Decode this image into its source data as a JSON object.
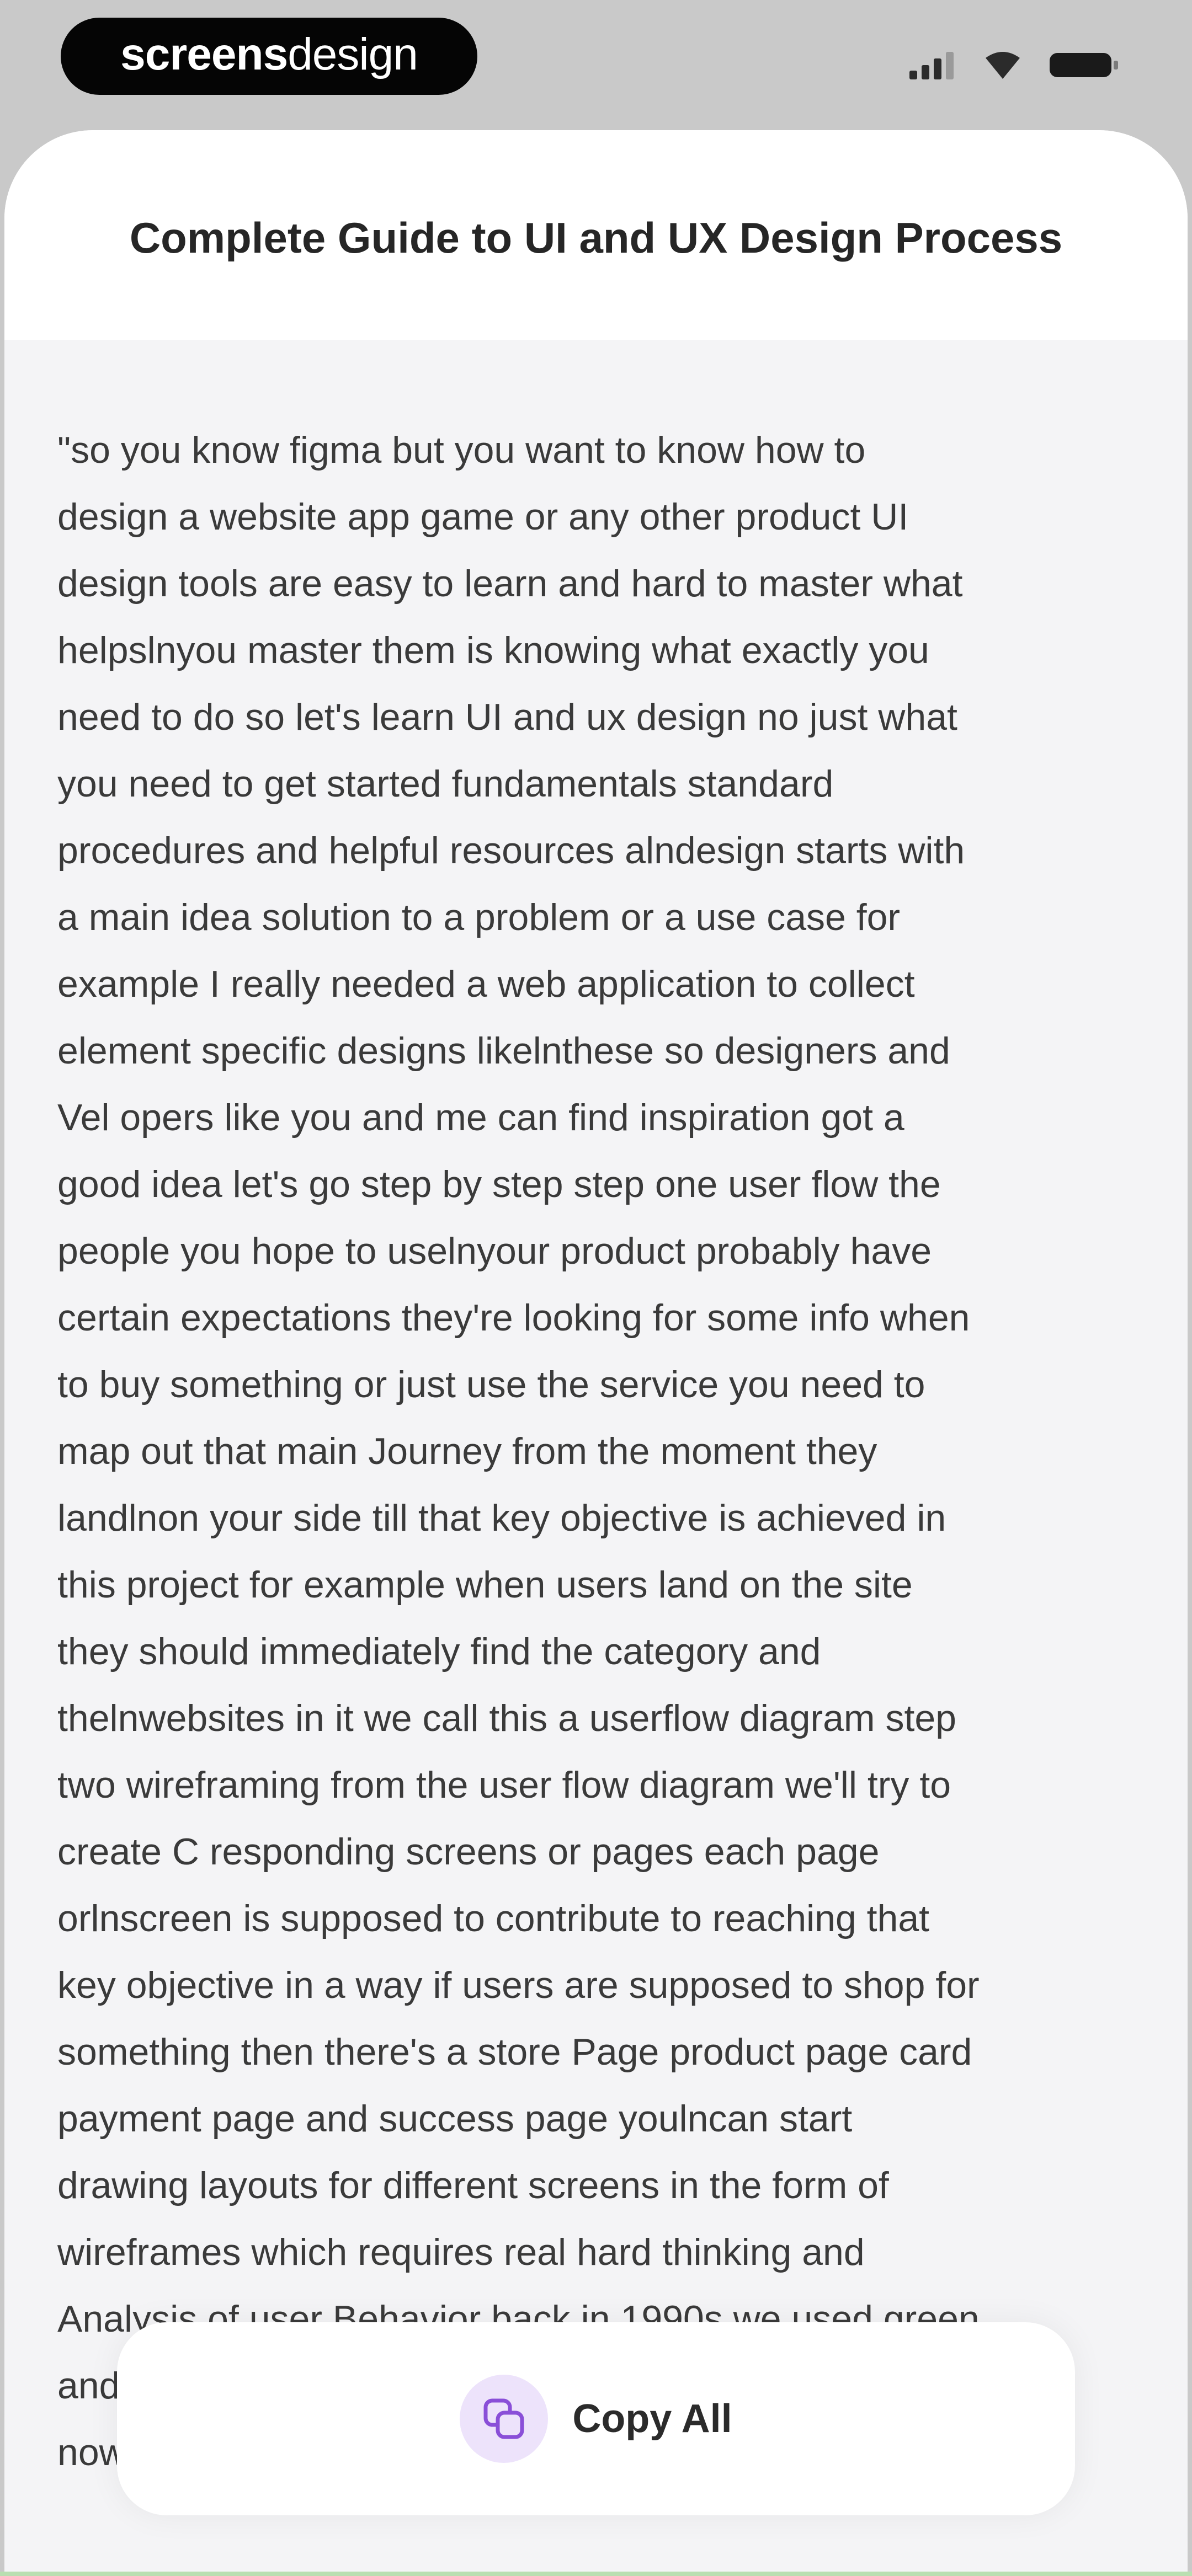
{
  "brand": {
    "part1": "screens",
    "part2": "design"
  },
  "header": {
    "title": "Complete Guide to UI and UX Design Process"
  },
  "transcript": {
    "text": "\"so you know figma but you want to know how to\ndesign a website app game or any other product UI\ndesign tools are easy to learn and hard to master what\nhelpslnyou master them is knowing what exactly you\nneed to do so let's learn UI and ux design no just what\nyou need to get started fundamentals standard\nprocedures and helpful resources alndesign starts with\na main idea solution to a problem or a use case for\nexample I really needed a web application to collect\nelement specific designs likelnthese so designers and\nVel opers like you and me can find inspiration got a\ngood idea let's go step by step step one user flow the\npeople you hope to uselnyour product probably have\ncertain expectations they're looking for some info when\nto buy something or just use the service you need to\nmap out that main Journey from the moment they\nlandlnon your side till that key objective is achieved in\nthis project for example when users land on the site\nthey should immediately find the category and\nthelnwebsites in it we call this a userflow diagram step\ntwo wireframing from the user flow diagram we'll try to\ncreate C responding screens or pages each page\norlnscreen is supposed to contribute to reaching that\nkey objective in a way if users are supposed to shop for\nsomething then there's a store Page product page card\npayment page and success page youlncan start\ndrawing layouts for different screens in the form of\nwireframes which requires real hard thinking and\nAnalysis of user Behavior back in 1990s we used green\nand\nnow"
  },
  "actions": {
    "copy_label": "Copy All"
  },
  "icons": {
    "signal": "signal-icon",
    "wifi": "wifi-icon",
    "battery": "battery-icon",
    "copy": "copy-icon"
  },
  "colors": {
    "accent": "#8a4fd8",
    "accent_bg": "#ede3fb"
  }
}
